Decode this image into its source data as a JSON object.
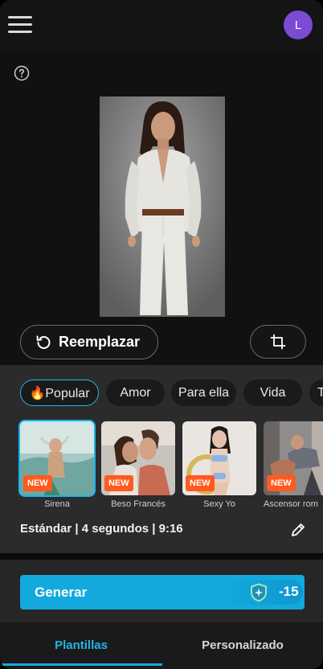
{
  "header": {
    "avatar_initial": "L",
    "menu_icon": "hamburger-menu-icon"
  },
  "preview": {
    "help_icon": "question-circle-icon",
    "replace_label": "Reemplazar",
    "replace_icon": "rotate-ccw-icon",
    "crop_icon": "crop-icon"
  },
  "categories": [
    {
      "label": "🔥Popular",
      "active": true
    },
    {
      "label": "Amor",
      "active": false
    },
    {
      "label": "Para ella",
      "active": false
    },
    {
      "label": "Vida",
      "active": false
    },
    {
      "label": "T",
      "active": false
    }
  ],
  "templates": [
    {
      "name": "Sirena",
      "badge": "NEW",
      "active": true
    },
    {
      "name": "Beso Francés",
      "badge": "NEW",
      "active": false
    },
    {
      "name": "Sexy Yo",
      "badge": "NEW",
      "active": false
    },
    {
      "name": "Ascensor rom",
      "badge": "NEW",
      "active": false
    }
  ],
  "settings": {
    "summary": "Estándar | 4 segundos  | 9:16",
    "edit_icon": "pencil-icon"
  },
  "generate": {
    "label": "Generar",
    "cost": "-15",
    "cost_icon": "credit-shield-icon",
    "accent": "#14a9dd"
  },
  "tabs": [
    {
      "label": "Plantillas",
      "active": true
    },
    {
      "label": "Personalizado",
      "active": false
    }
  ]
}
